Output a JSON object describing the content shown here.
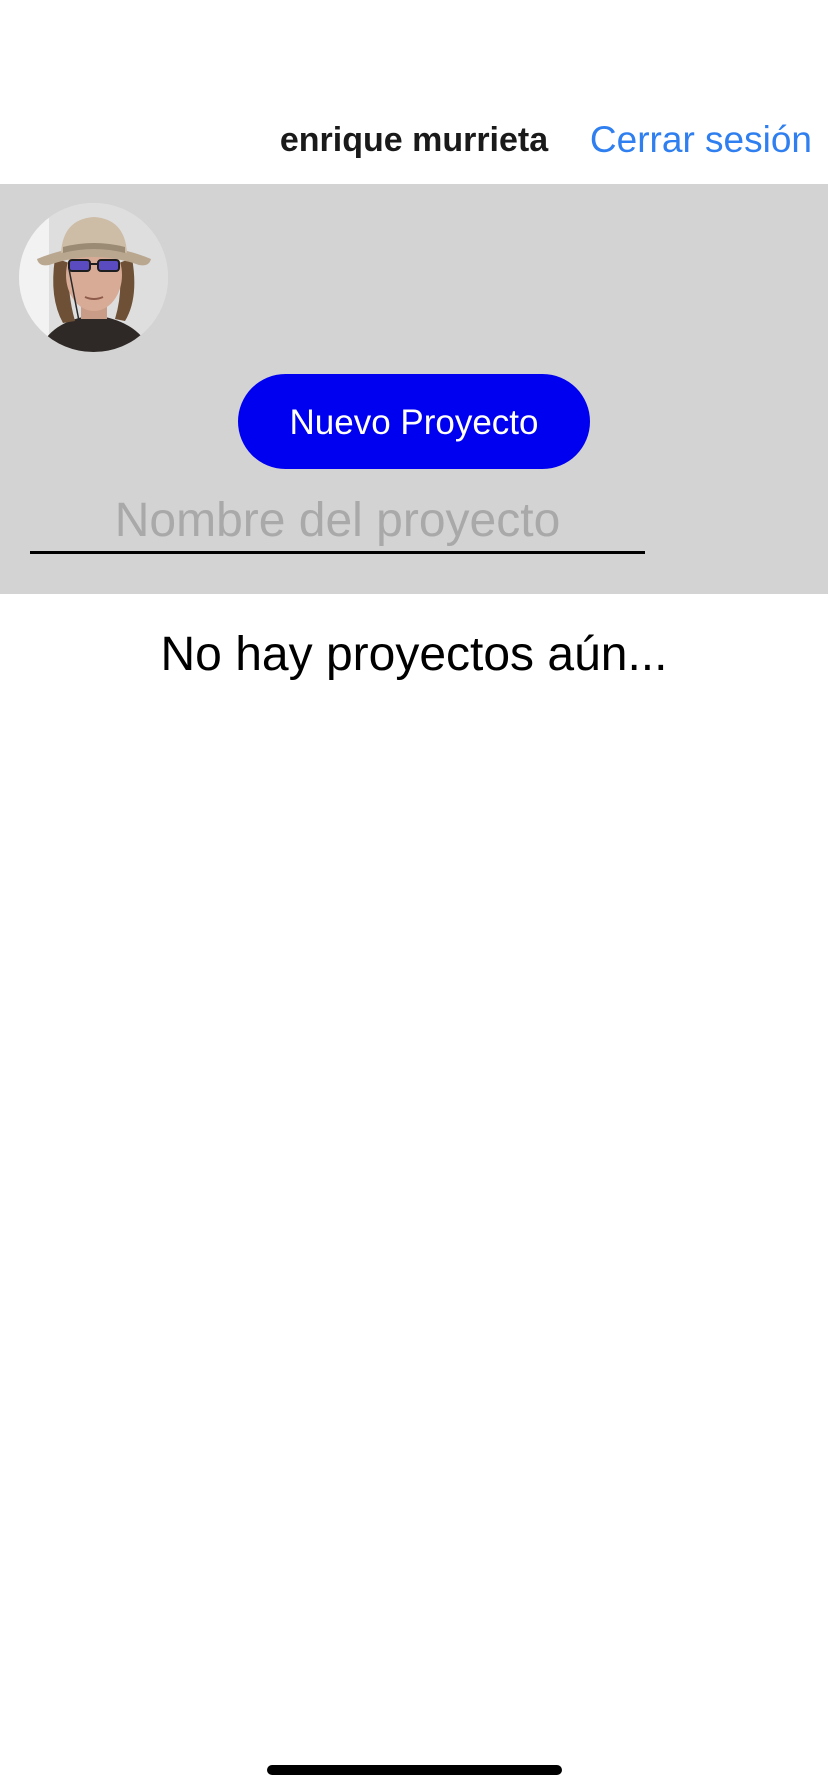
{
  "navbar": {
    "title": "enrique murrieta",
    "logout_label": "Cerrar sesión"
  },
  "panel": {
    "avatar_icon": "user-photo-avatar",
    "new_project_label": "Nuevo Proyecto",
    "project_name": {
      "value": "",
      "placeholder": "Nombre del proyecto"
    }
  },
  "projects": {
    "empty_message": "No hay proyectos aún..."
  },
  "colors": {
    "accent_link": "#2f7ff0",
    "primary_button": "#0000f0",
    "panel_background": "#d3d3d3"
  }
}
